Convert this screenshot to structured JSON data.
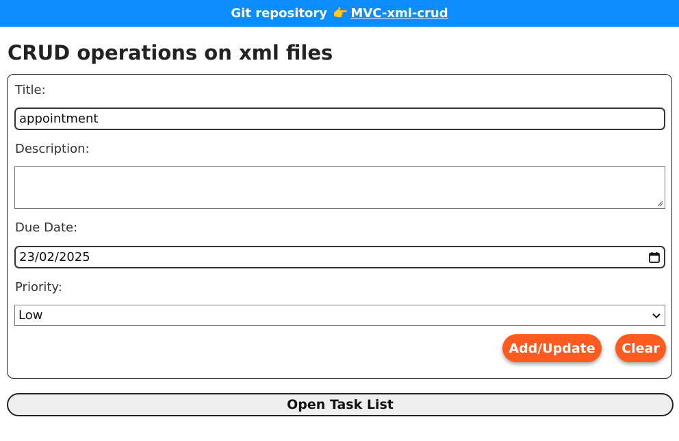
{
  "header": {
    "label": "Git repository",
    "icon": "pointing-hand-icon",
    "icon_glyph": "👉",
    "link_text": "MVC-xml-crud",
    "bg_color": "#0b8cff"
  },
  "page": {
    "title": "CRUD operations on xml files"
  },
  "form": {
    "title_label": "Title:",
    "title_value": "appointment",
    "description_label": "Description:",
    "description_value": "",
    "due_date_label": "Due Date:",
    "due_date_value": "23/02/2025",
    "priority_label": "Priority:",
    "priority_value": "Low",
    "add_update_label": "Add/Update",
    "clear_label": "Clear",
    "accent_color": "#ff5a1f"
  },
  "footer": {
    "open_task_list_label": "Open Task List"
  }
}
